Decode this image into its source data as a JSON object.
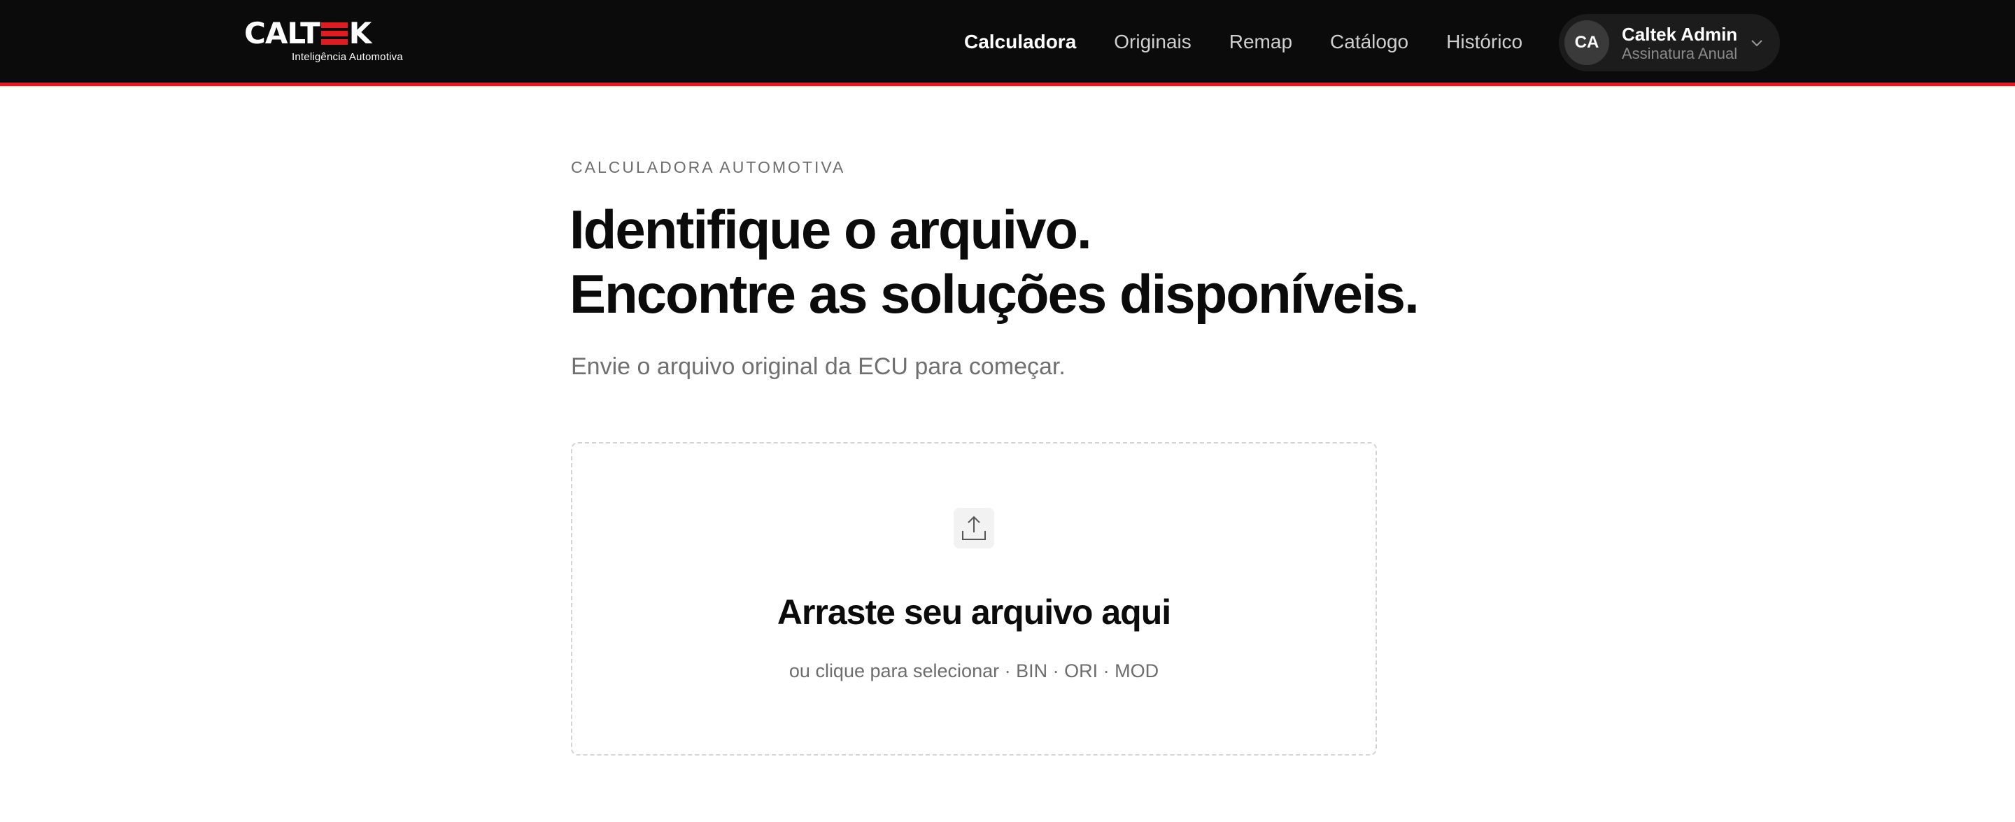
{
  "brand": {
    "logo_left": "CALT",
    "logo_right": "K",
    "tagline": "Inteligência Automotiva",
    "accent_color": "#e01b22"
  },
  "nav": {
    "items": [
      {
        "label": "Calculadora",
        "active": true
      },
      {
        "label": "Originais",
        "active": false
      },
      {
        "label": "Remap",
        "active": false
      },
      {
        "label": "Catálogo",
        "active": false
      },
      {
        "label": "Histórico",
        "active": false
      }
    ]
  },
  "user": {
    "initials": "CA",
    "name": "Caltek Admin",
    "plan": "Assinatura Anual",
    "menu_icon": "chevron-down-icon"
  },
  "main": {
    "eyebrow": "CALCULADORA AUTOMOTIVA",
    "headline_line1": "Identifique o arquivo.",
    "headline_line2": "Encontre as soluções disponíveis.",
    "lede": "Envie o arquivo original da ECU para começar."
  },
  "upload": {
    "icon": "upload-icon",
    "title": "Arraste seu arquivo aqui",
    "subtitle": "ou clique para selecionar · BIN · ORI · MOD"
  }
}
